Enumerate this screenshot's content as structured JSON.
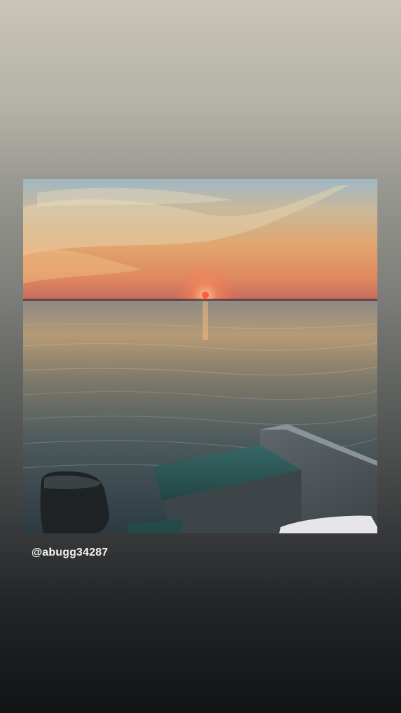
{
  "story": {
    "mention": "@abugg34287"
  },
  "colors": {
    "background_top": "#c8c4b6",
    "background_bottom": "#121315",
    "sun": "#ff5a3c",
    "sky_warm": "#e89a5a",
    "water": "#3a4a52",
    "boat_seat": "#2e5a58",
    "boat_hull": "#4a5257"
  },
  "icons": {
    "photo": "sunset-boat-photo",
    "outboard_motor": "outboard-motor",
    "boat_bench": "boat-bench",
    "boat_hull": "boat-hull",
    "boat_cushion": "boat-cushion"
  }
}
